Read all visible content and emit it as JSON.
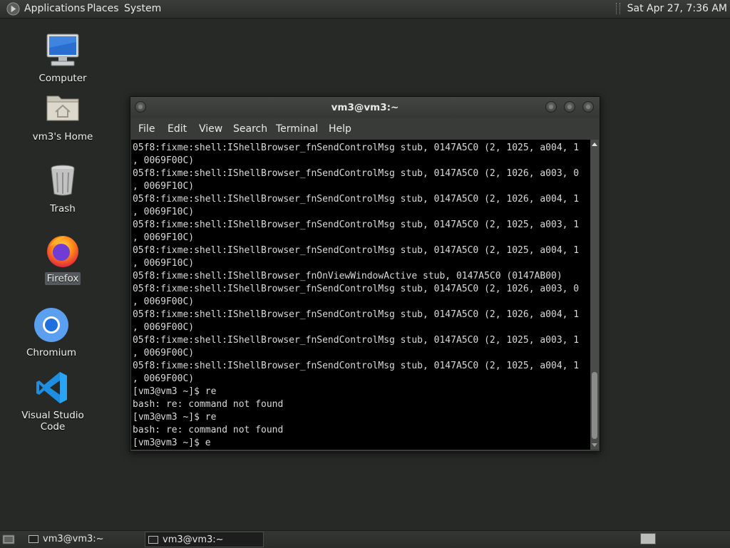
{
  "top_panel": {
    "menus": [
      "Applications",
      "Places",
      "System"
    ],
    "clock": "Sat Apr 27,  7:36 AM"
  },
  "desktop": {
    "icons": [
      {
        "label": "Computer",
        "icon": "computer-icon"
      },
      {
        "label": "vm3's Home",
        "icon": "home-folder-icon"
      },
      {
        "label": "Trash",
        "icon": "trash-icon"
      },
      {
        "label": "Firefox",
        "icon": "firefox-icon"
      },
      {
        "label": "Chromium",
        "icon": "chromium-icon"
      },
      {
        "label": "Visual Studio Code",
        "icon": "vscode-icon"
      }
    ]
  },
  "terminal": {
    "title": "vm3@vm3:~",
    "menu": [
      "File",
      "Edit",
      "View",
      "Search",
      "Terminal",
      "Help"
    ],
    "lines": [
      "05f8:fixme:shell:IShellBrowser_fnSendControlMsg stub, 0147A5C0 (2, 1025, a004, 1",
      ", 0069F00C)",
      "05f8:fixme:shell:IShellBrowser_fnSendControlMsg stub, 0147A5C0 (2, 1026, a003, 0",
      ", 0069F10C)",
      "05f8:fixme:shell:IShellBrowser_fnSendControlMsg stub, 0147A5C0 (2, 1026, a004, 1",
      ", 0069F10C)",
      "05f8:fixme:shell:IShellBrowser_fnSendControlMsg stub, 0147A5C0 (2, 1025, a003, 1",
      ", 0069F10C)",
      "05f8:fixme:shell:IShellBrowser_fnSendControlMsg stub, 0147A5C0 (2, 1025, a004, 1",
      ", 0069F10C)",
      "05f8:fixme:shell:IShellBrowser_fnOnViewWindowActive stub, 0147A5C0 (0147AB00)",
      "05f8:fixme:shell:IShellBrowser_fnSendControlMsg stub, 0147A5C0 (2, 1026, a003, 0",
      ", 0069F00C)",
      "05f8:fixme:shell:IShellBrowser_fnSendControlMsg stub, 0147A5C0 (2, 1026, a004, 1",
      ", 0069F00C)",
      "05f8:fixme:shell:IShellBrowser_fnSendControlMsg stub, 0147A5C0 (2, 1025, a003, 1",
      ", 0069F00C)",
      "05f8:fixme:shell:IShellBrowser_fnSendControlMsg stub, 0147A5C0 (2, 1025, a004, 1",
      ", 0069F00C)",
      "[vm3@vm3 ~]$ re",
      "bash: re: command not found",
      "[vm3@vm3 ~]$ re",
      "bash: re: command not found",
      "[vm3@vm3 ~]$ e"
    ]
  },
  "taskbar": {
    "tasks": [
      {
        "label": "vm3@vm3:~",
        "active": false
      },
      {
        "label": "vm3@vm3:~",
        "active": true
      }
    ]
  },
  "colors": {
    "desktop_bg": "#262926",
    "panel_bg": "#2e302e",
    "terminal_bg": "#000000",
    "terminal_fg": "#d9d9d9"
  }
}
